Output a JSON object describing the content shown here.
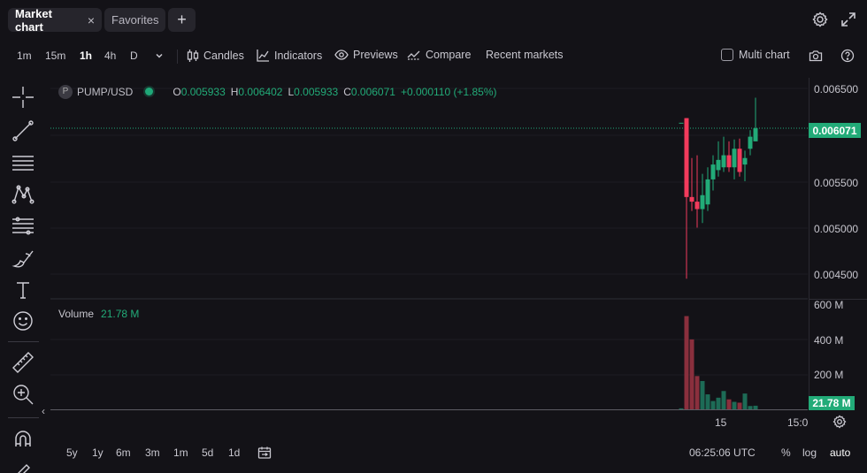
{
  "tabs": {
    "market_chart": "Market chart",
    "close": "×",
    "favorites": "Favorites",
    "add": "+"
  },
  "toolbar": {
    "timeframes": [
      "1m",
      "15m",
      "1h",
      "4h",
      "D"
    ],
    "active_timeframe": "1h",
    "candles": "Candles",
    "indicators": "Indicators",
    "previews": "Previews",
    "compare": "Compare",
    "recent_markets": "Recent markets",
    "multi_chart": "Multi chart"
  },
  "legend": {
    "symbol": "PUMP/USD",
    "symbol_icon": "P",
    "o_label": "O",
    "o_value": "0.005933",
    "h_label": "H",
    "h_value": "0.006402",
    "l_label": "L",
    "l_value": "0.005933",
    "c_label": "C",
    "c_value": "0.006071",
    "change": "+0.000110 (+1.85%)"
  },
  "volume_legend": {
    "label": "Volume",
    "value": "21.78 M"
  },
  "price_scale": {
    "labels": [
      "0.006500",
      "0.006000",
      "0.005500",
      "0.005000",
      "0.004500"
    ],
    "current": "0.006071"
  },
  "volume_scale": {
    "labels": [
      "600 M",
      "400 M",
      "200 M"
    ],
    "current": "21.78 M"
  },
  "time_axis": {
    "labels": [
      "15",
      "15:0"
    ]
  },
  "bottom": {
    "ranges": [
      "5y",
      "1y",
      "6m",
      "3m",
      "1m",
      "5d",
      "1d"
    ],
    "clock": "06:25:06 UTC",
    "percent": "%",
    "log": "log",
    "auto": "auto"
  },
  "colors": {
    "up": "#22ab78",
    "down": "#f23b5c",
    "vol_up": "#1d6b56",
    "vol_down": "#8a2f3d",
    "background": "#131217"
  },
  "chart_data": {
    "type": "candlestick",
    "price_range": [
      0.0044,
      0.0067
    ],
    "current_price": 0.006071,
    "candles": [
      {
        "o": 0.00613,
        "h": 0.00613,
        "l": 0.00613,
        "c": 0.00613
      },
      {
        "o": 0.00618,
        "h": 0.00618,
        "l": 0.00445,
        "c": 0.00533
      },
      {
        "o": 0.00533,
        "h": 0.00575,
        "l": 0.00518,
        "c": 0.00528
      },
      {
        "o": 0.00528,
        "h": 0.00578,
        "l": 0.005,
        "c": 0.0052
      },
      {
        "o": 0.0052,
        "h": 0.00558,
        "l": 0.00505,
        "c": 0.00535
      },
      {
        "o": 0.00525,
        "h": 0.00565,
        "l": 0.00518,
        "c": 0.00552
      },
      {
        "o": 0.00552,
        "h": 0.00578,
        "l": 0.0054,
        "c": 0.00568
      },
      {
        "o": 0.00562,
        "h": 0.00593,
        "l": 0.00555,
        "c": 0.00573
      },
      {
        "o": 0.00565,
        "h": 0.00598,
        "l": 0.0056,
        "c": 0.00578
      },
      {
        "o": 0.00578,
        "h": 0.00593,
        "l": 0.0056,
        "c": 0.00565
      },
      {
        "o": 0.00565,
        "h": 0.00595,
        "l": 0.00552,
        "c": 0.00585
      },
      {
        "o": 0.00585,
        "h": 0.00596,
        "l": 0.00555,
        "c": 0.0056
      },
      {
        "o": 0.00568,
        "h": 0.00583,
        "l": 0.0055,
        "c": 0.00575
      },
      {
        "o": 0.00585,
        "h": 0.00605,
        "l": 0.00578,
        "c": 0.00598
      },
      {
        "o": 0.00593,
        "h": 0.0064,
        "l": 0.00593,
        "c": 0.00607
      }
    ],
    "volume_range": [
      0,
      700
    ],
    "volumes": [
      6,
      560,
      420,
      200,
      170,
      90,
      50,
      70,
      110,
      60,
      45,
      40,
      95,
      20,
      21.78
    ]
  }
}
